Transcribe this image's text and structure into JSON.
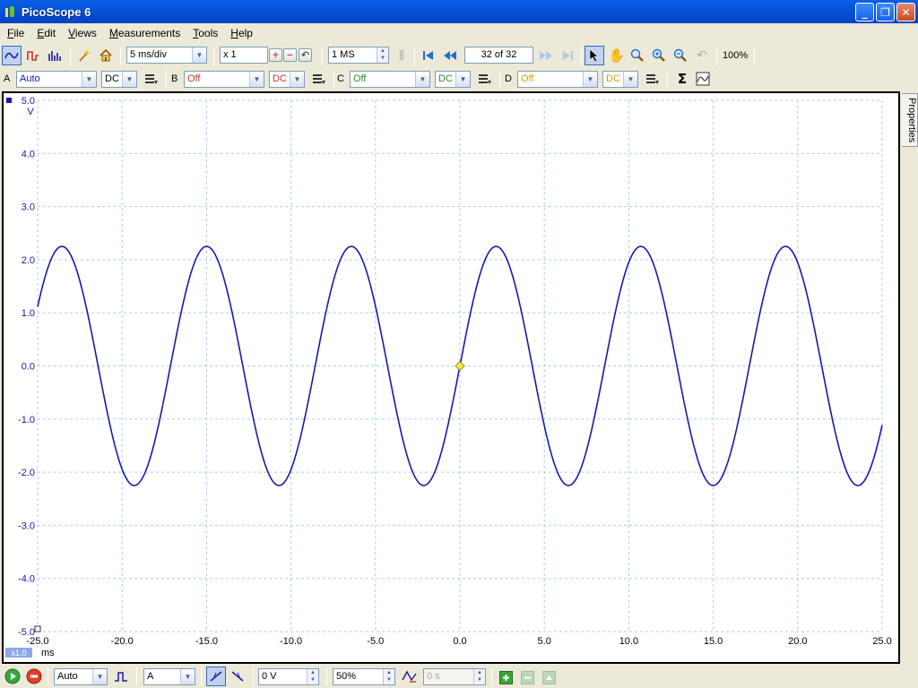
{
  "window": {
    "title": "PicoScope 6"
  },
  "menu": [
    {
      "label": "File",
      "accel": "F",
      "rest": "ile"
    },
    {
      "label": "Edit",
      "accel": "E",
      "rest": "dit"
    },
    {
      "label": "Views",
      "accel": "V",
      "rest": "iews"
    },
    {
      "label": "Measurements",
      "accel": "M",
      "rest": "easurements"
    },
    {
      "label": "Tools",
      "accel": "T",
      "rest": "ools"
    },
    {
      "label": "Help",
      "accel": "H",
      "rest": "elp"
    }
  ],
  "toolbar": {
    "timebase": "5 ms/div",
    "zoom_factor": "x 1",
    "samples": "1 MS",
    "buffer": "32 of 32",
    "zoom_percent": "100%"
  },
  "channels": [
    {
      "letter": "A",
      "range": "Auto",
      "coupling": "DC",
      "color": "#1a1aa6"
    },
    {
      "letter": "B",
      "range": "Off",
      "coupling": "DC",
      "color": "#c0392b"
    },
    {
      "letter": "C",
      "range": "Off",
      "coupling": "DC",
      "color": "#2e8b2e"
    },
    {
      "letter": "D",
      "range": "Off",
      "coupling": "DC",
      "color": "#c8a400"
    }
  ],
  "chart_data": {
    "type": "line",
    "ylabel": "V",
    "xlabel": "ms",
    "xlim": [
      -25,
      25
    ],
    "ylim": [
      -5,
      5
    ],
    "x_ticks": [
      "-25.0",
      "-20.0",
      "-15.0",
      "-10.0",
      "-5.0",
      "0.0",
      "5.0",
      "10.0",
      "15.0",
      "20.0",
      "25.0"
    ],
    "y_ticks": [
      "5.0",
      "4.0",
      "3.0",
      "2.0",
      "1.0",
      "0.0",
      "-1.0",
      "-2.0",
      "-3.0",
      "-4.0",
      "-5.0"
    ],
    "grid": true,
    "series": [
      {
        "amplitude": 2.25,
        "frequency_hz": 116.7,
        "trace_color": "#1a1aa6"
      }
    ],
    "trigger_marker": {
      "x": 0,
      "y": 0,
      "color": "#f5e642"
    },
    "zoom_badge": "x1.0"
  },
  "properties_tab": "Properties",
  "bottom": {
    "trigger_mode": "Auto",
    "trigger_source": "A",
    "threshold": "0 V",
    "pre_trigger": "50%",
    "delay": "0 s"
  }
}
